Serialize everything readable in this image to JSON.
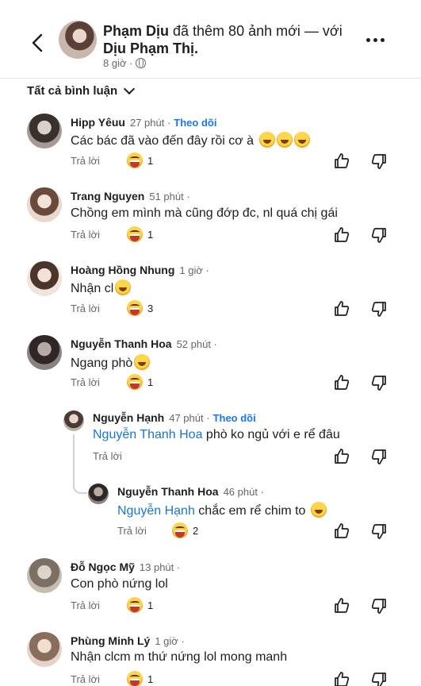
{
  "post": {
    "author": "Phạm Dịu",
    "action": " đã thêm 80 ảnh mới — với ",
    "tagged": "Dịu Phạm Thị.",
    "time": "8 giờ ·"
  },
  "filter": {
    "label": "Tất cả bình luận"
  },
  "comments": [
    {
      "name": "Hipp Yêuu",
      "time": "27 phút ·",
      "follow": "Theo dõi",
      "text": "Các bác đã vào đến đây rồi cơ à",
      "emojis": 3,
      "reply": "Trả lời",
      "reactions": "1"
    },
    {
      "name": "Trang Nguyen",
      "time": "51 phút ·",
      "text": "Chồng em mình mà cũng đớp đc, nl quá chị gái",
      "reply": "Trả lời",
      "reactions": "1"
    },
    {
      "name": "Hoàng Hồng Nhung",
      "time": "1 giờ ·",
      "text": "Nhận cl",
      "emojis": 1,
      "reply": "Trả lời",
      "reactions": "3"
    },
    {
      "name": "Nguyễn Thanh Hoa",
      "time": "52 phút ·",
      "text": "Ngang phò",
      "emojis": 1,
      "reply": "Trả lời",
      "reactions": "1"
    },
    {
      "name": "Nguyễn Hạnh",
      "time": "47 phút ·",
      "follow": "Theo dõi",
      "mention": "Nguyễn Thanh Hoa",
      "text": " phò ko ngủ với e rể đâu",
      "reply": "Trả lời",
      "reactions": ""
    },
    {
      "name": "Nguyễn Thanh Hoa",
      "time": "46 phút ·",
      "mention": "Nguyễn Hạnh",
      "text": " chắc em rể chim to",
      "emojis": 1,
      "reply": "Trả lời",
      "reactions": "2"
    },
    {
      "name": "Đỗ Ngọc Mỹ",
      "time": "13 phút ·",
      "text": "Con phò nứng lol",
      "reply": "Trả lời",
      "reactions": "1"
    },
    {
      "name": "Phùng Minh Lý",
      "time": "1 giờ ·",
      "text": "Nhận clcm m thứ nứng lol mong manh",
      "reply": "Trả lời",
      "reactions": "1"
    }
  ],
  "icons": {
    "back": "chevron-left-icon",
    "more": "more-icon",
    "like": "thumbs-up-icon",
    "dislike": "thumbs-down-icon",
    "reaction": "haha-reaction-icon"
  },
  "colors": {
    "link": "#1877f2",
    "muted": "#65676b",
    "text": "#1c1e21"
  }
}
